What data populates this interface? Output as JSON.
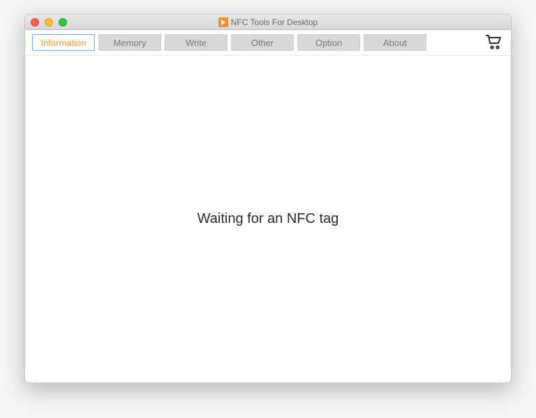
{
  "window": {
    "title": "NFC Tools For Desktop"
  },
  "tabs": {
    "information": "Information",
    "memory": "Memory",
    "write": "Write",
    "other": "Other",
    "option": "Option",
    "about": "About"
  },
  "main": {
    "waiting_message": "Waiting for an NFC tag"
  },
  "icons": {
    "app": "app-icon",
    "cart": "cart-icon"
  },
  "colors": {
    "accent": "#f29a1f",
    "tab_border_active": "#6fb9e6"
  }
}
